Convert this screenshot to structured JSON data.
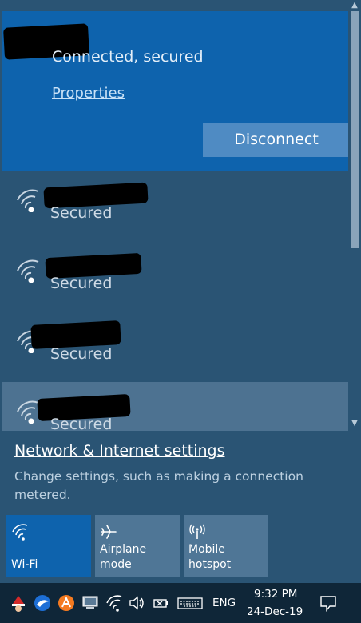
{
  "connected": {
    "status": "Connected, secured",
    "properties_label": "Properties",
    "disconnect_label": "Disconnect"
  },
  "networks": [
    {
      "status": "Secured"
    },
    {
      "status": "Secured"
    },
    {
      "status": "Secured"
    },
    {
      "status": "Secured"
    }
  ],
  "settings": {
    "title": "Network & Internet settings",
    "description": "Change settings, such as making a connection metered."
  },
  "quick_actions": [
    {
      "label": "Wi-Fi",
      "icon": "wifi-icon",
      "state": "on"
    },
    {
      "label": "Airplane mode",
      "icon": "airplane-icon",
      "state": "off"
    },
    {
      "label": "Mobile hotspot",
      "icon": "hotspot-icon",
      "state": "off"
    }
  ],
  "taskbar": {
    "language": "ENG",
    "time": "9:32 PM",
    "date": "24-Dec-19",
    "icons": [
      "santa-app-icon",
      "eagle-app-icon",
      "avast-icon",
      "computer-icon",
      "wifi-tray-icon",
      "volume-icon",
      "battery-plug-icon",
      "keyboard-icon",
      "notifications-icon"
    ]
  },
  "colors": {
    "accent": "#0e63ad",
    "panel": "#2a5474",
    "highlight": "#4d7291",
    "taskbar": "#0f2638"
  }
}
